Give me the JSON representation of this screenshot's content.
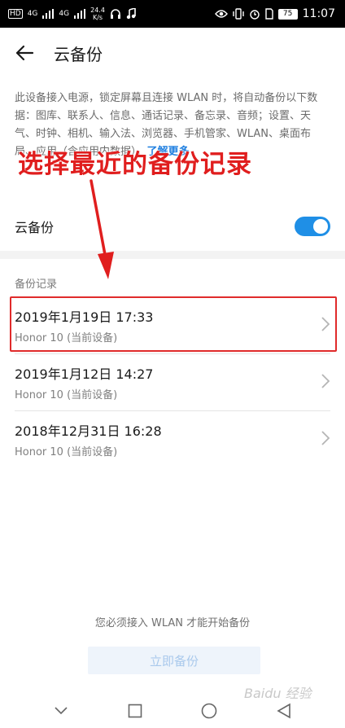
{
  "status_bar": {
    "signal1": "4G",
    "signal2": "4G",
    "speed_value": "24.4",
    "speed_unit": "K/s",
    "battery": "75",
    "time": "11:07"
  },
  "header": {
    "title": "云备份"
  },
  "description": {
    "text": "此设备接入电源，锁定屏幕且连接 WLAN 时，将自动备份以下数据：图库、联系人、信息、通话记录、备忘录、音频；设置、天气、时钟、相机、输入法、浏览器、手机管家、WLAN、桌面布局、应用（含应用内数据）。",
    "learn_more": "了解更多"
  },
  "toggle": {
    "label": "云备份",
    "state": "on",
    "accent": "#1f8fe6"
  },
  "records": {
    "section_label": "备份记录",
    "items": [
      {
        "date": "2019年1月19日 17:33",
        "device": "Honor 10 (当前设备)"
      },
      {
        "date": "2019年1月12日 14:27",
        "device": "Honor 10 (当前设备)"
      },
      {
        "date": "2018年12月31日 16:28",
        "device": "Honor 10 (当前设备)"
      }
    ]
  },
  "footer": {
    "note": "您必须接入 WLAN 才能开始备份",
    "button": "立即备份"
  },
  "annotation": {
    "text": "选择最近的备份记录",
    "color": "#e01e1e"
  },
  "watermark": "Baidu 经验"
}
